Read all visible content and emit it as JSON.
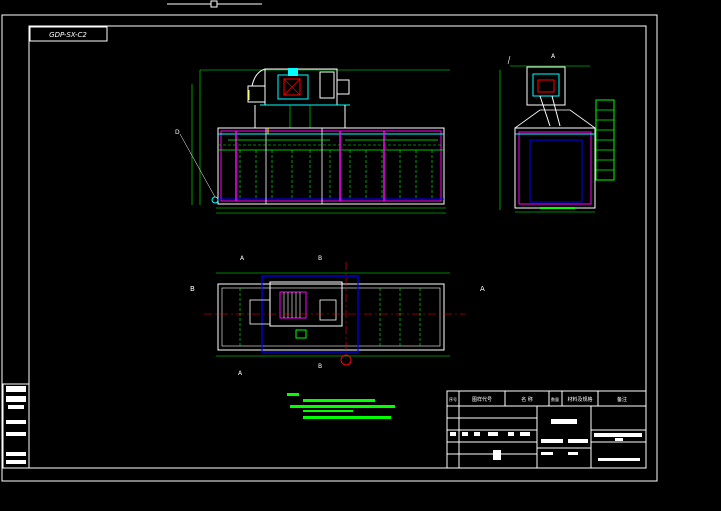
{
  "drawing": {
    "code_box": "GDP-SX-C2",
    "view_marks": {
      "a_top": "A",
      "a_left_plan": "A",
      "a_right_plan": "A",
      "b_left_plan": "B",
      "b_top_plan": "B",
      "b_bottom_plan": "B",
      "d_label": "D",
      "a_bottom_plan": "A"
    },
    "title_block": {
      "header_cells": [
        "序号",
        "图样代号",
        "名  称",
        "数量",
        "材料及规格",
        "备注"
      ]
    }
  },
  "colors": {
    "background": "#000000",
    "frame": "#ffffff",
    "cyan": "#00ffff",
    "green": "#00ff00",
    "magenta": "#ff00ff",
    "blue": "#0000ff",
    "red": "#ff0000",
    "yellow": "#ffff00"
  }
}
